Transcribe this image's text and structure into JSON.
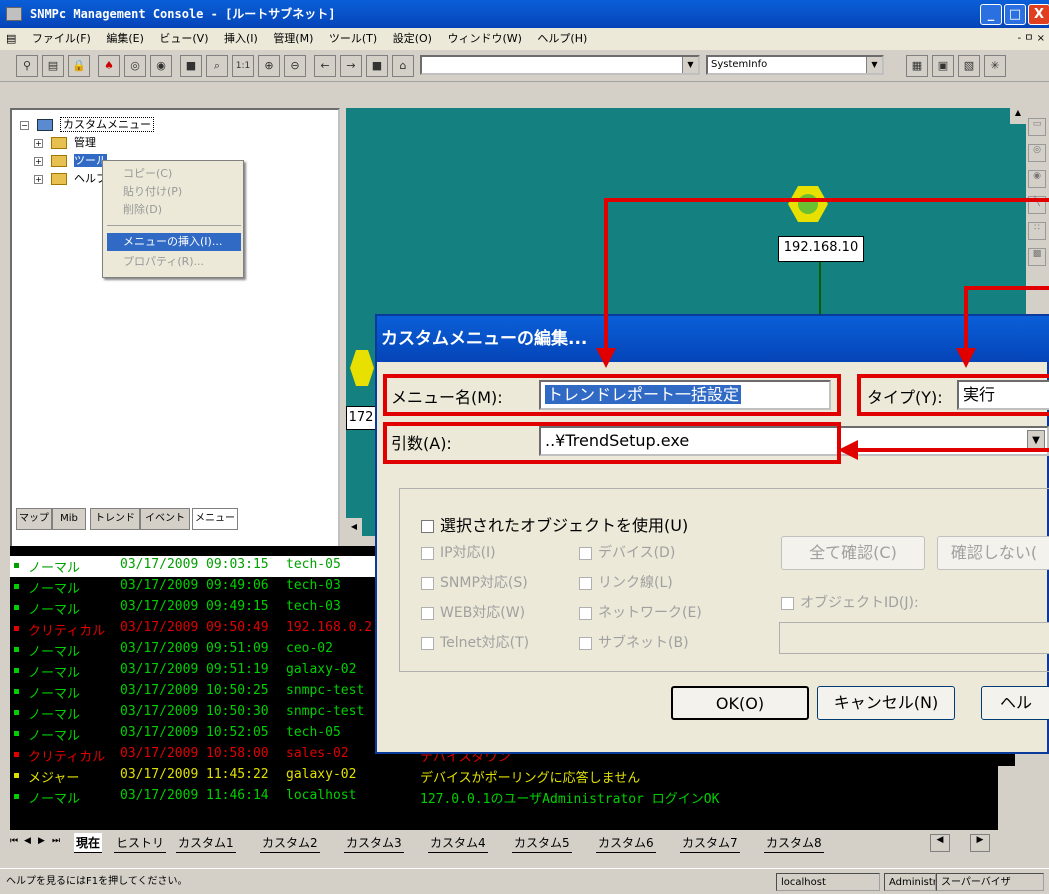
{
  "window": {
    "title": "SNMPc Management Console - [ルートサブネット]",
    "min_label": "_",
    "max_label": "□",
    "close_label": "X"
  },
  "menubar": {
    "items": [
      "ファイル(F)",
      "編集(E)",
      "ビュー(V)",
      "挿入(I)",
      "管理(M)",
      "ツール(T)",
      "設定(O)",
      "ウィンドウ(W)",
      "ヘルプ(H)"
    ],
    "right_controls": "- ㅁ ×"
  },
  "toolbar": {
    "combo1_value": "",
    "combo2_value": "SystemInfo"
  },
  "tree": {
    "root": "カスタムメニュー",
    "items": [
      "管理",
      "ツール",
      "ヘルプ"
    ]
  },
  "context_menu": {
    "items": [
      "コピー(C)",
      "貼り付け(P)",
      "削除(D)",
      "メニューの挿入(I)...",
      "プロパティ(R)..."
    ]
  },
  "panel_tabs": [
    "マップ",
    "Mib",
    "トレンド",
    "イベント",
    "メニュー"
  ],
  "map": {
    "node1_ip": "192.168.10",
    "node2_ip": "172"
  },
  "dialog": {
    "title": "カスタムメニューの編集...",
    "menu_name_label": "メニュー名(M):",
    "menu_name_value": "トレンドレポート一括設定",
    "type_label": "タイプ(Y):",
    "type_value": "実行",
    "args_label": "引数(A):",
    "args_value": "..¥TrendSetup.exe",
    "use_selected_label": "選択されたオブジェクトを使用(U)",
    "options_left": [
      "IP対応(I)",
      "SNMP対応(S)",
      "WEB対応(W)",
      "Telnet対応(T)"
    ],
    "options_mid": [
      "デバイス(D)",
      "リンク線(L)",
      "ネットワーク(E)",
      "サブネット(B)"
    ],
    "confirm_all": "全て確認(C)",
    "confirm_none": "確認しない(",
    "object_id_label": "オブジェクトID(J):",
    "ok": "OK(O)",
    "cancel": "キャンセル(N)",
    "help": "ヘル"
  },
  "event_log": {
    "rows": [
      {
        "severity": "ノーマル",
        "date": "03/17/2009",
        "time": "09:03:15",
        "source": "tech-05",
        "message": "",
        "color": "#00d000"
      },
      {
        "severity": "ノーマル",
        "date": "03/17/2009",
        "time": "09:49:06",
        "source": "tech-03",
        "message": "",
        "color": "#00d000"
      },
      {
        "severity": "ノーマル",
        "date": "03/17/2009",
        "time": "09:49:15",
        "source": "tech-03",
        "message": "",
        "color": "#00d000"
      },
      {
        "severity": "クリティカル",
        "date": "03/17/2009",
        "time": "09:50:49",
        "source": "192.168.0.2",
        "message": "",
        "color": "#e00000"
      },
      {
        "severity": "ノーマル",
        "date": "03/17/2009",
        "time": "09:51:09",
        "source": "ceo-02",
        "message": "",
        "color": "#00d000"
      },
      {
        "severity": "ノーマル",
        "date": "03/17/2009",
        "time": "09:51:19",
        "source": "galaxy-02",
        "message": "",
        "color": "#00d000"
      },
      {
        "severity": "ノーマル",
        "date": "03/17/2009",
        "time": "10:50:25",
        "source": "snmpc-test",
        "message": "",
        "color": "#00d000"
      },
      {
        "severity": "ノーマル",
        "date": "03/17/2009",
        "time": "10:50:30",
        "source": "snmpc-test",
        "message": "",
        "color": "#00d000"
      },
      {
        "severity": "ノーマル",
        "date": "03/17/2009",
        "time": "10:52:05",
        "source": "tech-05",
        "message": "",
        "color": "#00d000"
      },
      {
        "severity": "クリティカル",
        "date": "03/17/2009",
        "time": "10:58:00",
        "source": "sales-02",
        "message": "デバイスダウン",
        "color": "#e00000"
      },
      {
        "severity": "メジャー",
        "date": "03/17/2009",
        "time": "11:45:22",
        "source": "galaxy-02",
        "message": "デバイスがポーリングに応答しません",
        "color": "#e0e000"
      },
      {
        "severity": "ノーマル",
        "date": "03/17/2009",
        "time": "11:46:14",
        "source": "localhost",
        "message": "127.0.0.1のユーザAdministrator ログインOK",
        "color": "#00d000"
      }
    ]
  },
  "bottom_tabs": [
    "現在",
    "ヒストリ",
    "カスタム1",
    "カスタム2",
    "カスタム3",
    "カスタム4",
    "カスタム5",
    "カスタム6",
    "カスタム7",
    "カスタム8"
  ],
  "status": {
    "help_text": "ヘルプを見るにはF1を押してください。",
    "host": "localhost",
    "user": "Administr",
    "role": "スーパーバイザ"
  }
}
